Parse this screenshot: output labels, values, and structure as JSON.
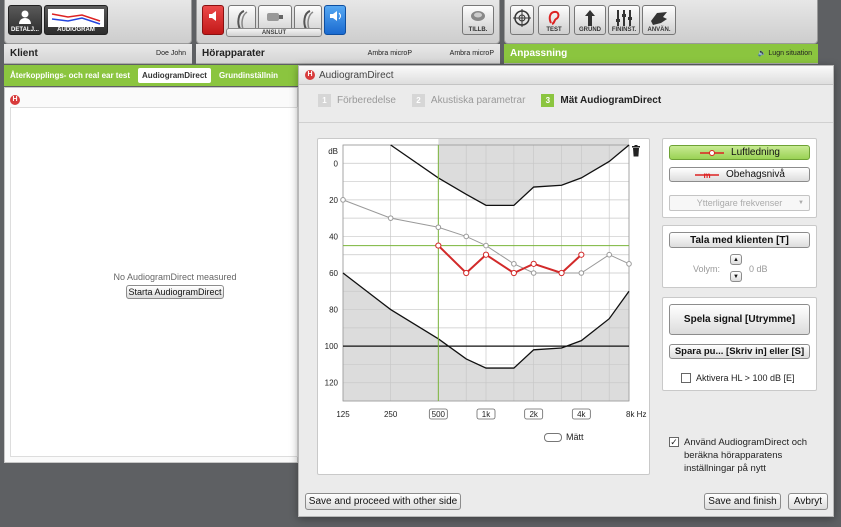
{
  "toolbar": {
    "details_label": "DETALJ...",
    "audiogram_label": "AUDIOGRAM",
    "anslut_label": "ANSLUT",
    "tillb_label": "TILLB.",
    "test_label": "TEST",
    "grund_label": "GRUND",
    "fininst_label": "FININST.",
    "anvan_label": "ANVÄN."
  },
  "sections": {
    "klient_title": "Klient",
    "klient_name": "Doe John",
    "horapparater_title": "Hörapparater",
    "horapparater_left": "Ambra microP",
    "horapparater_right": "Ambra microP",
    "anpassning_title": "Anpassning",
    "anpassning_status": "Lugn situation"
  },
  "client_panel": {
    "tabs": [
      "Återkopplings- och real ear test",
      "AudiogramDirect",
      "Grundinställnin"
    ],
    "empty_message": "No AudiogramDirect measured",
    "start_button": "Starta AudiogramDirect"
  },
  "dialog": {
    "title": "AudiogramDirect",
    "steps": [
      {
        "num": "1",
        "label": "Förberedelse"
      },
      {
        "num": "2",
        "label": "Akustiska parametrar"
      },
      {
        "num": "3",
        "label": "Mät AudiogramDirect"
      }
    ],
    "legend_luft": "Luftledning",
    "legend_obehag": "Obehagsnivå",
    "extra_freq_placeholder": "Ytterligare frekvenser",
    "talk_button": "Tala med klienten  [T]",
    "volume_label": "Volym:",
    "volume_value": "0 dB",
    "play_button": "Spela signal  [Utrymme]",
    "save_button": "Spara pu...  [Skriv in] eller [S]",
    "activate_hl": "Aktivera HL > 100 dB [E]",
    "use_audiogram": "Använd AudiogramDirect och beräkna hörapparatens inställningar på nytt",
    "matt_label": "Mätt",
    "btn_proceed": "Save and proceed with other side",
    "btn_save_finish": "Save and finish",
    "btn_abort": "Avbryt"
  },
  "chart_data": {
    "type": "line",
    "ylabel": "dB",
    "x_ticks": [
      "125",
      "250",
      "500",
      "1k",
      "2k",
      "4k",
      "8k Hz"
    ],
    "boxed_x_ticks": [
      "500",
      "1k",
      "2k",
      "4k"
    ],
    "y_ticks": [
      "0",
      "20",
      "40",
      "60",
      "80",
      "100",
      "120"
    ],
    "ylim": [
      -10,
      130
    ],
    "x": [
      125,
      250,
      500,
      750,
      1000,
      1500,
      2000,
      3000,
      4000,
      6000,
      8000
    ],
    "series": [
      {
        "name": "Luftledning",
        "values": [
          null,
          null,
          45,
          60,
          50,
          60,
          55,
          60,
          50,
          null,
          null
        ],
        "color": "#d22a2a"
      },
      {
        "values": [
          20,
          30,
          35,
          40,
          45,
          55,
          60,
          60,
          60,
          50,
          55
        ],
        "color": "#9a9a9a"
      }
    ],
    "reference_line_green_db": 45,
    "reference_line_green_x": 500,
    "reference_line_black_db": 100
  }
}
